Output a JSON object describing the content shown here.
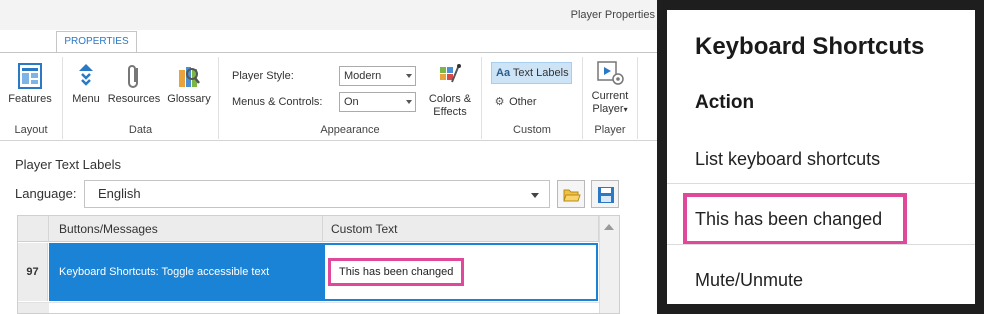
{
  "window": {
    "title": "Player Properties"
  },
  "ribbon": {
    "tab": "PROPERTIES",
    "groups": {
      "layout": {
        "label": "Layout",
        "features_label": "Features"
      },
      "data": {
        "label": "Data",
        "menu_label": "Menu",
        "resources_label": "Resources",
        "glossary_label": "Glossary"
      },
      "appearance": {
        "label": "Appearance",
        "player_style_label": "Player Style:",
        "player_style_value": "Modern",
        "menus_controls_label": "Menus & Controls:",
        "menus_controls_value": "On",
        "colors_effects_label_1": "Colors &",
        "colors_effects_label_2": "Effects"
      },
      "custom": {
        "label": "Custom",
        "text_labels_label": "Text Labels",
        "text_labels_glyph": "Aa",
        "other_label": "Other"
      },
      "player": {
        "label": "Player",
        "current_player_label_1": "Current",
        "current_player_label_2": "Player"
      }
    }
  },
  "text_labels": {
    "title": "Player Text Labels",
    "language_label": "Language:",
    "language_value": "English",
    "columns": [
      "Buttons/Messages",
      "Custom Text"
    ],
    "rows": [
      {
        "num": "97",
        "message": "Keyboard Shortcuts: Toggle accessible text",
        "custom": "This has been changed"
      }
    ]
  },
  "keyboard_shortcuts": {
    "title": "Keyboard Shortcuts",
    "column_header": "Action",
    "items": [
      "List keyboard shortcuts",
      "This has been changed",
      "Mute/Unmute"
    ]
  },
  "colors": {
    "selection_blue": "#1a83d5",
    "highlight_pink": "#e0489c",
    "accent_blue": "#2b78c5"
  }
}
